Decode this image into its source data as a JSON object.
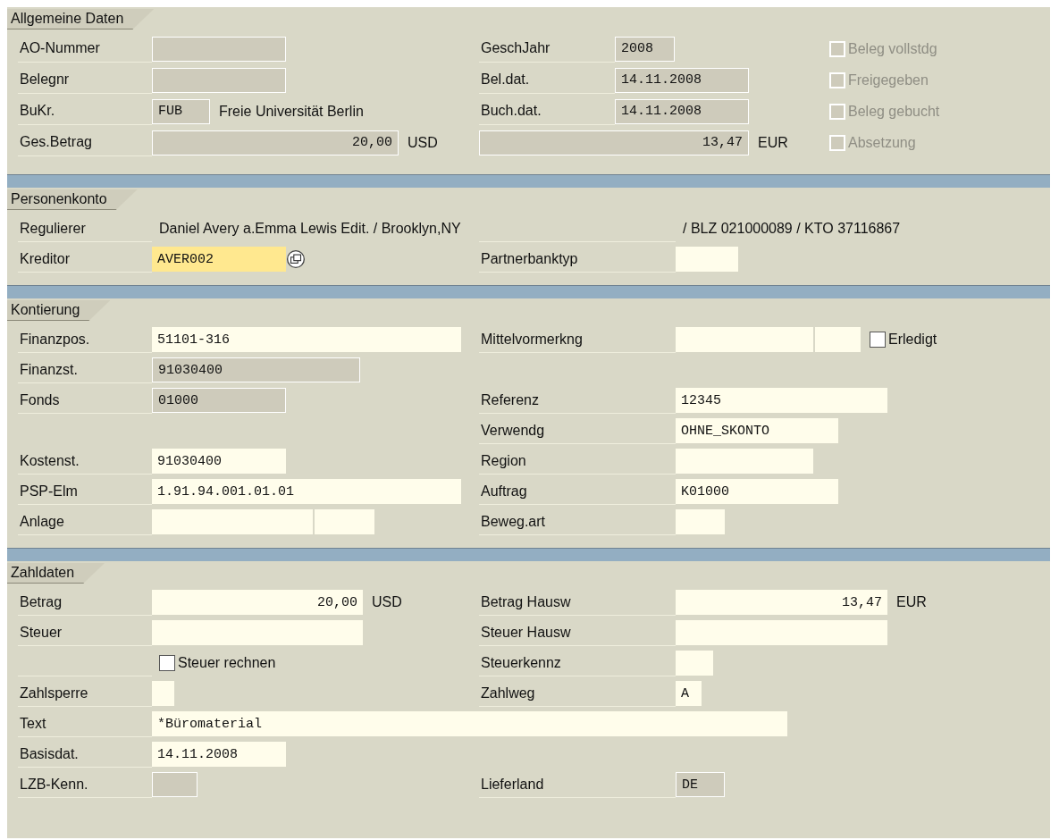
{
  "sections": [
    {
      "title": "Allgemeine Daten",
      "rows": [
        {
          "left": {
            "label": "AO-Nummer",
            "fields": [
              {
                "editable": false
              }
            ]
          },
          "right": {
            "label": "GeschJahr",
            "fields": [
              {
                "value": "2008",
                "editable": false
              }
            ]
          },
          "flag": {
            "label": "Beleg vollstdg",
            "checked": false,
            "disabled": true
          }
        },
        {
          "left": {
            "label": "Belegnr",
            "fields": [
              {
                "editable": false
              }
            ]
          },
          "right": {
            "label": "Bel.dat.",
            "fields": [
              {
                "value": "14.11.2008",
                "editable": false
              }
            ]
          },
          "flag": {
            "label": "Freigegeben",
            "checked": false,
            "disabled": true
          }
        },
        {
          "left": {
            "label": "BuKr.",
            "fields": [
              {
                "value": "FUB",
                "editable": false
              }
            ],
            "text": "Freie Universität Berlin"
          },
          "right": {
            "label": "Buch.dat.",
            "fields": [
              {
                "value": "14.11.2008",
                "editable": false
              }
            ]
          },
          "flag": {
            "label": "Beleg gebucht",
            "checked": false,
            "disabled": true
          }
        },
        {
          "left": {
            "label": "Ges.Betrag",
            "fields": [
              {
                "value": "20,00",
                "editable": false,
                "kind": "amount"
              }
            ],
            "unit": "USD"
          },
          "right": {
            "fields": [
              {
                "value": "13,47",
                "editable": false,
                "kind": "amount"
              }
            ],
            "unit": "EUR"
          },
          "flag": {
            "label": "Absetzung",
            "checked": false,
            "disabled": true
          }
        }
      ]
    },
    {
      "title": "Personenkonto",
      "rows": [
        {
          "left": {
            "label": "Regulierer",
            "text": "Daniel Avery a.Emma Lewis Edit. / Brooklyn,NY"
          },
          "right": {
            "text": "/ BLZ 021000089 / KTO 37116867"
          }
        },
        {
          "left": {
            "label": "Kreditor",
            "fields": [
              {
                "value": "AVER002",
                "editable": true,
                "focused": true
              }
            ],
            "help": true
          },
          "right": {
            "label": "Partnerbanktyp",
            "fields": [
              {
                "editable": true
              }
            ]
          }
        }
      ]
    },
    {
      "title": "Kontierung",
      "rows": [
        {
          "left": {
            "label": "Finanzpos.",
            "fields": [
              {
                "value": "51101-316",
                "editable": true
              }
            ]
          },
          "right": {
            "label": "Mittelvormerkng",
            "fields": [
              {
                "editable": true
              },
              {
                "editable": true
              }
            ],
            "check": {
              "label": "Erledigt",
              "checked": false,
              "disabled": false
            }
          }
        },
        {
          "left": {
            "label": "Finanzst.",
            "fields": [
              {
                "value": "91030400",
                "editable": false
              }
            ]
          }
        },
        {
          "left": {
            "label": "Fonds",
            "fields": [
              {
                "value": "01000",
                "editable": false
              }
            ]
          },
          "right": {
            "label": "Referenz",
            "fields": [
              {
                "value": "12345",
                "editable": true
              }
            ]
          }
        },
        {
          "right": {
            "label": "Verwendg",
            "fields": [
              {
                "value": "OHNE_SKONTO",
                "editable": true
              }
            ]
          }
        },
        {
          "left": {
            "label": "Kostenst.",
            "fields": [
              {
                "value": "91030400",
                "editable": true
              }
            ]
          },
          "right": {
            "label": "Region",
            "fields": [
              {
                "editable": true
              }
            ]
          }
        },
        {
          "left": {
            "label": "PSP-Elm",
            "fields": [
              {
                "value": "1.91.94.001.01.01",
                "editable": true
              }
            ]
          },
          "right": {
            "label": "Auftrag",
            "fields": [
              {
                "value": "K01000",
                "editable": true
              }
            ]
          }
        },
        {
          "left": {
            "label": "Anlage",
            "fields": [
              {
                "editable": true
              },
              {
                "editable": true
              }
            ]
          },
          "right": {
            "label": "Beweg.art",
            "fields": [
              {
                "editable": true
              }
            ]
          }
        }
      ]
    },
    {
      "title": "Zahldaten",
      "rows": [
        {
          "left": {
            "label": "Betrag",
            "fields": [
              {
                "value": "20,00",
                "editable": true,
                "kind": "amount"
              }
            ],
            "unit": "USD"
          },
          "right": {
            "label": "Betrag Hausw",
            "fields": [
              {
                "value": "13,47",
                "editable": true,
                "kind": "amount"
              }
            ],
            "unit": "EUR"
          }
        },
        {
          "left": {
            "label": "Steuer",
            "fields": [
              {
                "editable": true
              }
            ]
          },
          "right": {
            "label": "Steuer Hausw",
            "fields": [
              {
                "editable": true
              }
            ]
          }
        },
        {
          "left": {
            "check": {
              "label": "Steuer rechnen",
              "checked": false,
              "disabled": false
            }
          },
          "right": {
            "label": "Steuerkennz",
            "fields": [
              {
                "editable": true
              }
            ]
          }
        },
        {
          "left": {
            "label": "Zahlsperre",
            "fields": [
              {
                "editable": true
              }
            ]
          },
          "right": {
            "label": "Zahlweg",
            "fields": [
              {
                "value": "A",
                "editable": true
              }
            ]
          }
        },
        {
          "left": {
            "label": "Text",
            "fields": [
              {
                "value": "*Büromaterial",
                "editable": true
              }
            ]
          }
        },
        {
          "left": {
            "label": "Basisdat.",
            "fields": [
              {
                "value": "14.11.2008",
                "editable": true
              }
            ]
          }
        },
        {
          "left": {
            "label": "LZB-Kenn.",
            "fields": [
              {
                "editable": false
              }
            ]
          },
          "right": {
            "label": "Lieferland",
            "fields": [
              {
                "value": "DE",
                "editable": false
              }
            ]
          }
        }
      ]
    }
  ]
}
